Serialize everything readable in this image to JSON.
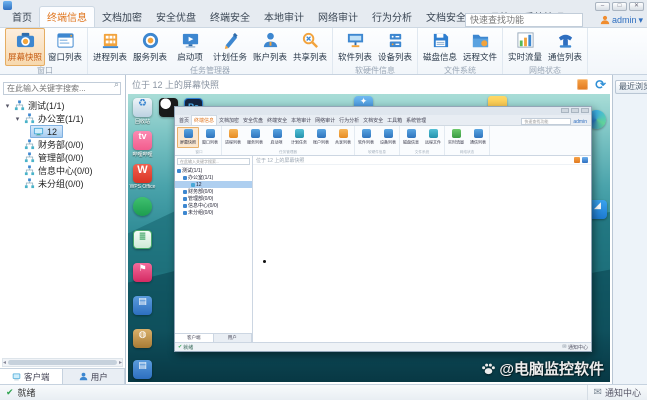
{
  "window_controls": {
    "minimize": "–",
    "maximize": "□",
    "close": "✕"
  },
  "tabs": [
    "首页",
    "终端信息",
    "文档加密",
    "安全优盘",
    "终端安全",
    "本地审计",
    "网络审计",
    "行为分析",
    "文档安全",
    "工具箱",
    "系统管理"
  ],
  "topbar": {
    "search_placeholder": "快速查找功能",
    "user_name": "admin",
    "caret": "▾"
  },
  "ribbon": {
    "groups": [
      "窗口",
      "任务管理器",
      "软硬件信息",
      "文件系统",
      "网络状态"
    ],
    "buttons": [
      "屏幕快照",
      "窗口列表",
      "进程列表",
      "服务列表",
      "启动项",
      "计划任务",
      "账户列表",
      "共享列表",
      "软件列表",
      "设备列表",
      "磁盘信息",
      "远程文件",
      "实时流量",
      "通信列表"
    ]
  },
  "sidebar": {
    "search_placeholder": "在此输入关键字搜索...",
    "tree": [
      "测试(1/1)",
      "办公室(1/1)",
      "12",
      "财务部(0/0)",
      "管理部(0/0)",
      "信息中心(0/0)",
      "未分组(0/0)"
    ],
    "tabs": [
      "客户端",
      "用户"
    ]
  },
  "main": {
    "header_title": "位于 12 上的屏幕快照"
  },
  "screenshot": {
    "desktop_icons_col1": [
      "回收站",
      "哔哩哔哩",
      "WPS Office",
      "",
      "",
      "",
      "",
      "",
      ""
    ],
    "ps_badge": "Ps",
    "wps_badge": "W",
    "watermark": "@电脑监控软件"
  },
  "right_panel": {
    "tab": "最近浏览记录"
  },
  "statusbar": {
    "ready": "就绪",
    "notification": "通知中心"
  },
  "icons": {
    "check": "✔",
    "envelope": "✉",
    "refresh": "⟳",
    "caret": "▾",
    "scroll_left": "◂",
    "scroll_right": "▸",
    "search": "⌕",
    "tree_arrow": "▾"
  }
}
